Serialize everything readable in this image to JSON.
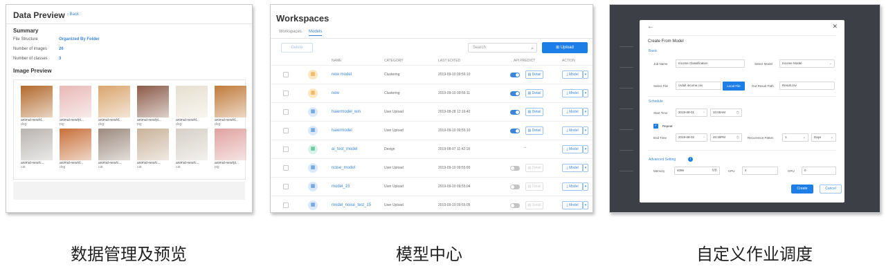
{
  "panel1": {
    "title": "Data Preview",
    "back": "Back",
    "summary_heading": "Summary",
    "rows": [
      {
        "label": "File Structure",
        "value": "Organized By Folder"
      },
      {
        "label": "Number of images",
        "value": "26"
      },
      {
        "label": "Number of classes",
        "value": "3"
      }
    ],
    "image_preview_heading": "Image Preview",
    "images": [
      {
        "file": "animal-new/d...",
        "label": "dog",
        "color": "#b2692c"
      },
      {
        "file": "animal-new/pi...",
        "label": "pig",
        "color": "#e8b8b6"
      },
      {
        "file": "animal-new/d...",
        "label": "dog",
        "color": "#d9a56e"
      },
      {
        "file": "animal-new/pi...",
        "label": "pig",
        "color": "#8a5a48"
      },
      {
        "file": "animal-new/d...",
        "label": "dog",
        "color": "#e6dfcf"
      },
      {
        "file": "animal-new/d...",
        "label": "dog",
        "color": "#c07a3a"
      },
      {
        "file": "animal-new/c...",
        "label": "cat",
        "color": "#b8b4b0"
      },
      {
        "file": "animal-new/d...",
        "label": "dog",
        "color": "#c8703a"
      },
      {
        "file": "animal-new/c...",
        "label": "cat",
        "color": "#9c8a7e"
      },
      {
        "file": "animal-new/c...",
        "label": "cat",
        "color": "#c9b29a"
      },
      {
        "file": "animal-new/c...",
        "label": "cat",
        "color": "#d5cfc6"
      },
      {
        "file": "animal-new/pi...",
        "label": "pig",
        "color": "#e0a2a0"
      }
    ],
    "caption": "数据管理及预览"
  },
  "panel2": {
    "title": "Workspaces",
    "tabs": [
      "Workspaces",
      "Models"
    ],
    "delete_label": "Delete",
    "search_placeholder": "Search",
    "upload_label": "Upload",
    "columns": [
      "NAME",
      "CATEGORY",
      "LAST EDITED",
      "API PREDICT",
      "ACTION"
    ],
    "detail_label": "Detail",
    "model_label": "Model",
    "rows": [
      {
        "name": "new model",
        "category": "Clustering",
        "date": "2019-09-10 09:56:10",
        "icon_bg": "#fde8c4",
        "icon_color": "#f0a030",
        "api": "on"
      },
      {
        "name": "new",
        "category": "Clustering",
        "date": "2019-09-10 09:56:11",
        "icon_bg": "#fde8c4",
        "icon_color": "#f0a030",
        "api": "on"
      },
      {
        "name": "haiermodel_win",
        "category": "User Upload",
        "date": "2019-08-28 12:16:42",
        "icon_bg": "#dce9fb",
        "icon_color": "#3b86d8",
        "api": "on"
      },
      {
        "name": "haiermodel",
        "category": "User Upload",
        "date": "2019-09-10 09:55:10",
        "icon_bg": "#dce9fb",
        "icon_color": "#3b86d8",
        "api": "on"
      },
      {
        "name": "ai_test_model",
        "category": "Design",
        "date": "2019-08-07 11:42:18",
        "icon_bg": "#d8f3ea",
        "icon_color": "#2fb380",
        "api": "none"
      },
      {
        "name": "noise_model",
        "category": "User Upload",
        "date": "2019-09-10 09:55:03",
        "icon_bg": "#dce9fb",
        "icon_color": "#3b86d8",
        "api": "off"
      },
      {
        "name": "model_15",
        "category": "User Upload",
        "date": "2019-09-10 09:55:04",
        "icon_bg": "#dce9fb",
        "icon_color": "#3b86d8",
        "api": "off"
      },
      {
        "name": "model_noise_test_15",
        "category": "User Upload",
        "date": "2019-09-10 09:55:05",
        "icon_bg": "#dce9fb",
        "icon_color": "#3b86d8",
        "api": "off"
      }
    ],
    "caption": "模型中心"
  },
  "panel3": {
    "title": "Create From Model",
    "basic": "Basic",
    "job_name_label": "Job Name",
    "job_name_value": "Income Classification",
    "select_model_label": "Select Model",
    "select_model_value": "Income Model",
    "select_file_label": "Select File",
    "select_file_value": "/Adult income.csv",
    "local_file": "Local File",
    "out_path_label": "Out Result Path",
    "out_path_value": "Result.csv",
    "schedule": "Schedule",
    "start_time_label": "Start Time",
    "start_date": "2019-08-01",
    "start_clock": "10:00AM",
    "repeat": "Repeat",
    "end_time_label": "End Time",
    "end_date": "2019-08-02",
    "end_clock": "20:30PM",
    "recurrence_label": "Recurrence Patten",
    "recurrence_value": "1",
    "recurrence_unit": "Days",
    "advanced": "Advanced Setting",
    "memory_label": "Memory",
    "memory_value": "4096",
    "memory_unit": "MB",
    "cpu_label": "CPU",
    "cpu_value": "4",
    "gpu_label": "GPU",
    "gpu_value": "0",
    "create": "Create",
    "cancel": "Cancel",
    "caption": "自定义作业调度"
  }
}
